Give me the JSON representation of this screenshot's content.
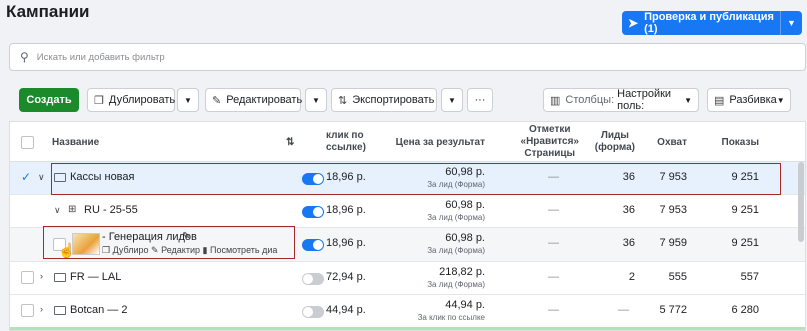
{
  "page": {
    "title": "Кампании"
  },
  "publish": {
    "label": "Проверка и публикация (1)",
    "icon": "rocket-icon"
  },
  "search": {
    "placeholder": "Искать или добавить фильтр"
  },
  "toolbar": {
    "create": "Создать",
    "duplicate": "Дублировать",
    "edit": "Редактировать",
    "export": "Экспортировать",
    "more": "···",
    "columns_prefix": "Столбцы:",
    "columns_value": "Настройки поль:",
    "breakdown": "Разбивка"
  },
  "table": {
    "headers": {
      "name": "Название",
      "cpc_line1": "клик по",
      "cpc_line2": "ссылке)",
      "cpr": "Цена за результат",
      "likes_line1": "Отметки",
      "likes_line2": "«Нравится»",
      "likes_line3": "Страницы",
      "leads_line1": "Лиды",
      "leads_line2": "(форма)",
      "reach": "Охват",
      "impressions": "Показы"
    },
    "rows": [
      {
        "name": "Кассы новая",
        "cpc": "18,96 р.",
        "cpr": "60,98 р.",
        "cpr_sub": "За лид (Форма)",
        "likes": "—",
        "leads": "36",
        "reach": "7 953",
        "impressions": "9 251"
      },
      {
        "name": "RU - 25-55",
        "cpc": "18,96 р.",
        "cpr": "60,98 р.",
        "cpr_sub": "За лид (Форма)",
        "likes": "—",
        "leads": "36",
        "reach": "7 953",
        "impressions": "9 251"
      },
      {
        "name": "- Генерация лидов",
        "action_duplicate": "Дублиро",
        "action_edit": "Редактир",
        "action_view": "Посмотреть диа",
        "cpc": "18,96 р.",
        "cpr": "60,98 р.",
        "cpr_sub": "За лид (Форма)",
        "likes": "—",
        "leads": "36",
        "reach": "7 959",
        "impressions": "9 251"
      },
      {
        "name": "FR — LAL",
        "cpc": "72,94 р.",
        "cpr": "218,82 р.",
        "cpr_sub": "За лид (Форма)",
        "likes": "—",
        "leads": "2",
        "reach": "555",
        "impressions": "557"
      },
      {
        "name": "Botcan — 2",
        "cpc": "44,94 р.",
        "cpr": "44,94 р.",
        "cpr_sub": "За клик по ссылке",
        "likes": "—",
        "leads": "—",
        "reach": "5 772",
        "impressions": "6 280"
      }
    ]
  }
}
